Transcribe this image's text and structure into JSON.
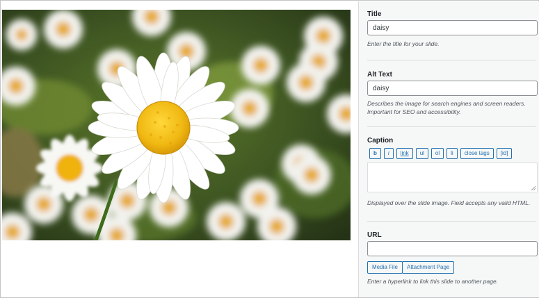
{
  "image": {
    "alt": "daisy"
  },
  "fields": {
    "title": {
      "label": "Title",
      "value": "daisy",
      "description": "Enter the title for your slide."
    },
    "alt_text": {
      "label": "Alt Text",
      "value": "daisy",
      "description": "Describes the image for search engines and screen readers. Important for SEO and accessibility."
    },
    "caption": {
      "label": "Caption",
      "toolbar": [
        "b",
        "i",
        "link",
        "ul",
        "ol",
        "li",
        "close tags",
        "[id]"
      ],
      "value": "",
      "description": "Displayed over the slide image. Field accepts any valid HTML."
    },
    "url": {
      "label": "URL",
      "value": "",
      "buttons": {
        "media_file": "Media File",
        "attachment_page": "Attachment Page"
      },
      "description": "Enter a hyperlink to link this slide to another page."
    }
  },
  "colors": {
    "accent": "#2271b1",
    "sidebar_bg": "#f6f7f7",
    "daisy_center": "#f2c21a"
  }
}
